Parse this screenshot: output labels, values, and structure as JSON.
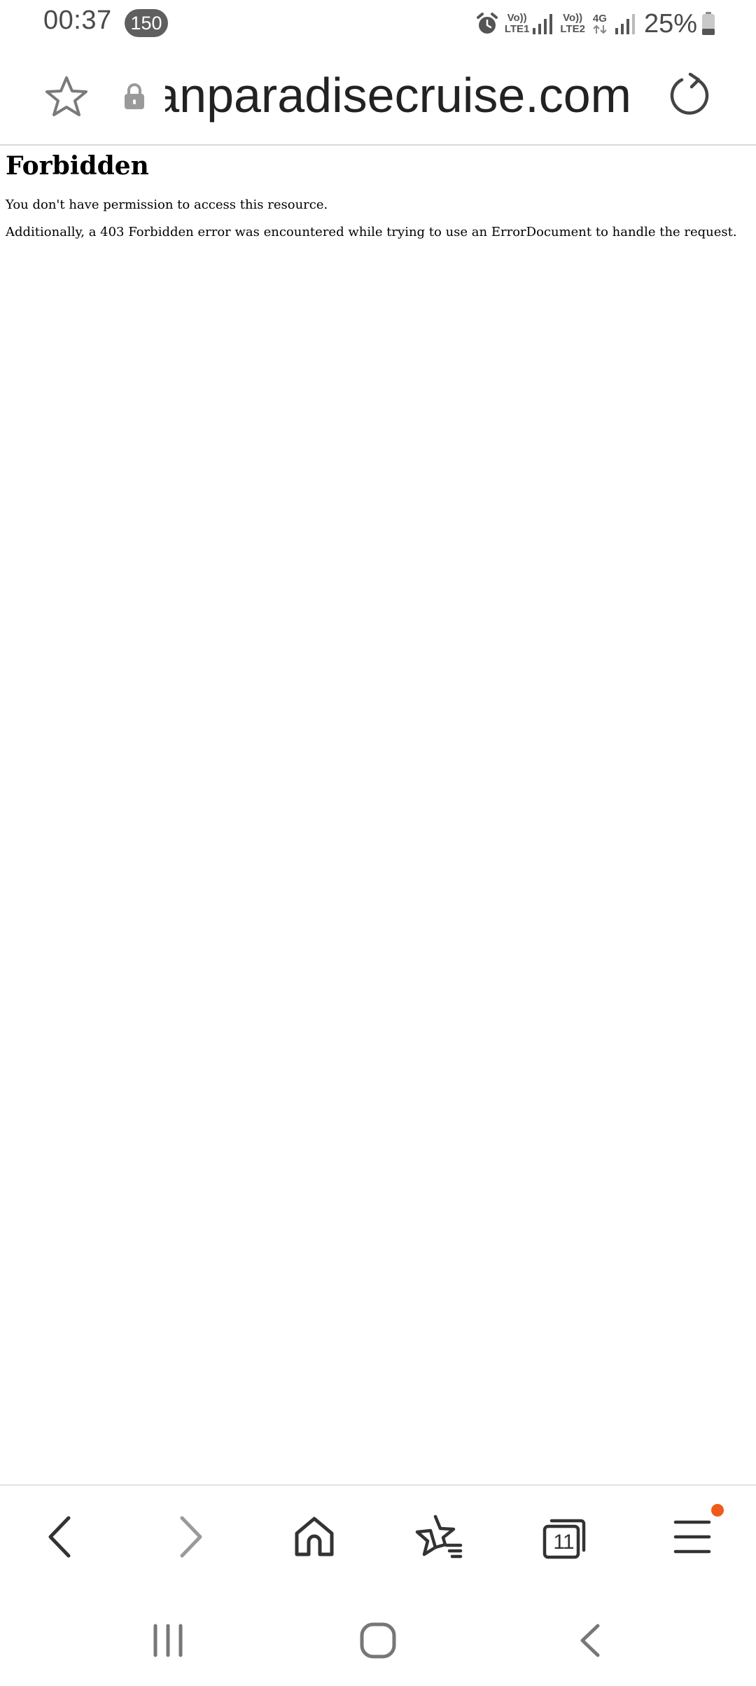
{
  "status_bar": {
    "time": "00:37",
    "notification_count": "150",
    "sim1_top": "Vo))",
    "sim1_bottom": "LTE1",
    "sim2_top": "Vo))",
    "sim2_bottom": "LTE2",
    "data_type": "4G",
    "battery_percent": "25%",
    "icons": [
      "alarm-icon",
      "signal-icon",
      "signal-icon",
      "data-arrows-icon",
      "signal-icon",
      "battery-icon"
    ]
  },
  "url_bar": {
    "url": "anparadisecruise.com",
    "icons": [
      "star-icon",
      "lock-icon",
      "reload-icon"
    ]
  },
  "page": {
    "title": "Forbidden",
    "paragraphs": [
      "You don't have permission to access this resource.",
      "Additionally, a 403 Forbidden error was encountered while trying to use an ErrorDocument to handle the request."
    ]
  },
  "toolbar": {
    "tab_count": "11",
    "icons": [
      "back-icon",
      "forward-icon",
      "home-icon",
      "bookmarks-icon",
      "tabs-icon",
      "menu-icon"
    ],
    "accent_color": "#ef5b1b"
  },
  "system_nav": {
    "icons": [
      "recents-icon",
      "home-icon",
      "back-icon"
    ]
  }
}
